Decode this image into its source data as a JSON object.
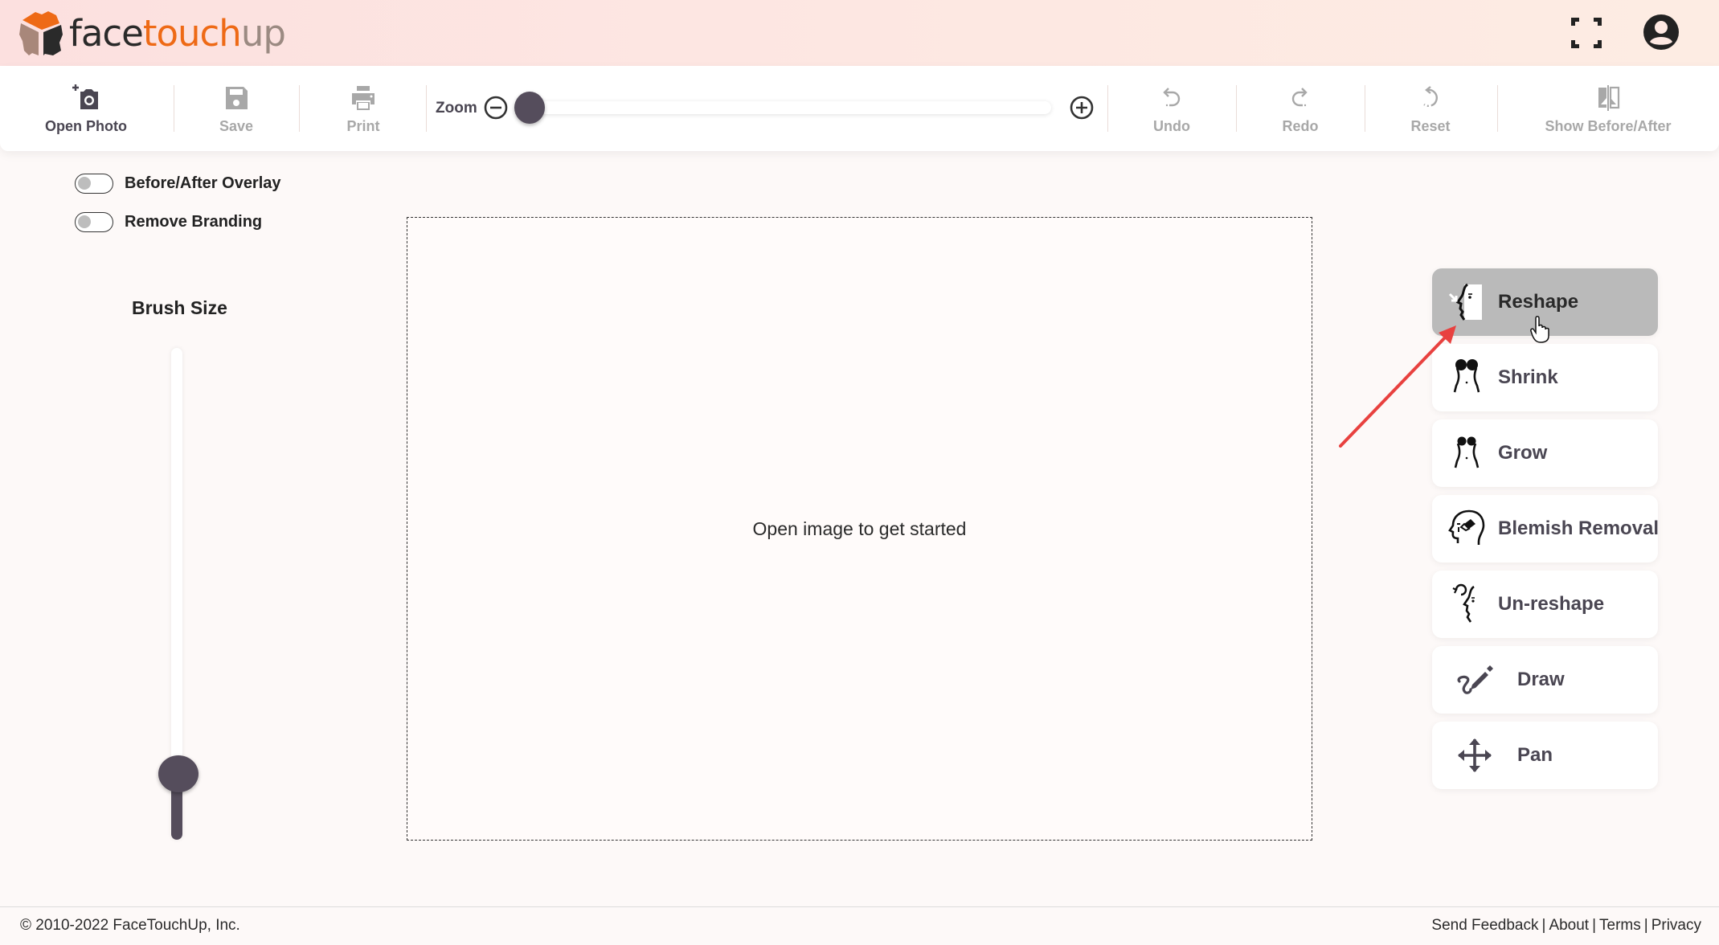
{
  "header": {
    "logo": {
      "part1": "face",
      "part2": "touch",
      "part3": "up"
    },
    "fullscreen_icon": "fullscreen-icon",
    "account_icon": "account-circle-icon"
  },
  "toolbar": {
    "open_photo": {
      "label": "Open Photo",
      "icon": "add-photo-camera-icon",
      "enabled": true
    },
    "save": {
      "label": "Save",
      "icon": "floppy-disk-icon",
      "enabled": false
    },
    "print": {
      "label": "Print",
      "icon": "printer-icon",
      "enabled": false
    },
    "zoom": {
      "label": "Zoom",
      "value_percent": 0
    },
    "undo": {
      "label": "Undo",
      "icon": "undo-icon",
      "enabled": false
    },
    "redo": {
      "label": "Redo",
      "icon": "redo-icon",
      "enabled": false
    },
    "reset": {
      "label": "Reset",
      "icon": "reset-icon",
      "enabled": false
    },
    "show_before_after": {
      "label": "Show Before/After",
      "icon": "compare-icon",
      "enabled": false
    }
  },
  "options": {
    "before_after_overlay": {
      "label": "Before/After Overlay",
      "on": false
    },
    "remove_branding": {
      "label": "Remove Branding",
      "on": false
    }
  },
  "brush": {
    "title": "Brush Size",
    "value_percent": 13
  },
  "canvas": {
    "message": "Open image to get started"
  },
  "tools": [
    {
      "label": "Reshape",
      "icon": "reshape-face-icon",
      "selected": true
    },
    {
      "label": "Shrink",
      "icon": "shrink-body-icon",
      "selected": false
    },
    {
      "label": "Grow",
      "icon": "grow-body-icon",
      "selected": false
    },
    {
      "label": "Blemish Removal",
      "icon": "blemish-removal-icon",
      "selected": false
    },
    {
      "label": "Un-reshape",
      "icon": "unreshape-face-icon",
      "selected": false
    },
    {
      "label": "Draw",
      "icon": "draw-pencil-icon",
      "selected": false
    },
    {
      "label": "Pan",
      "icon": "pan-move-icon",
      "selected": false
    }
  ],
  "footer": {
    "copyright": "© 2010-2022 FaceTouchUp, Inc.",
    "links": [
      "Send Feedback",
      "About",
      "Terms",
      "Privacy"
    ],
    "separator": "|"
  },
  "colors": {
    "accent_orange": "#ee6a16",
    "slider_thumb": "#554d5c",
    "selected_tool_bg": "#bababa",
    "annotation_arrow": "#e8413f"
  }
}
